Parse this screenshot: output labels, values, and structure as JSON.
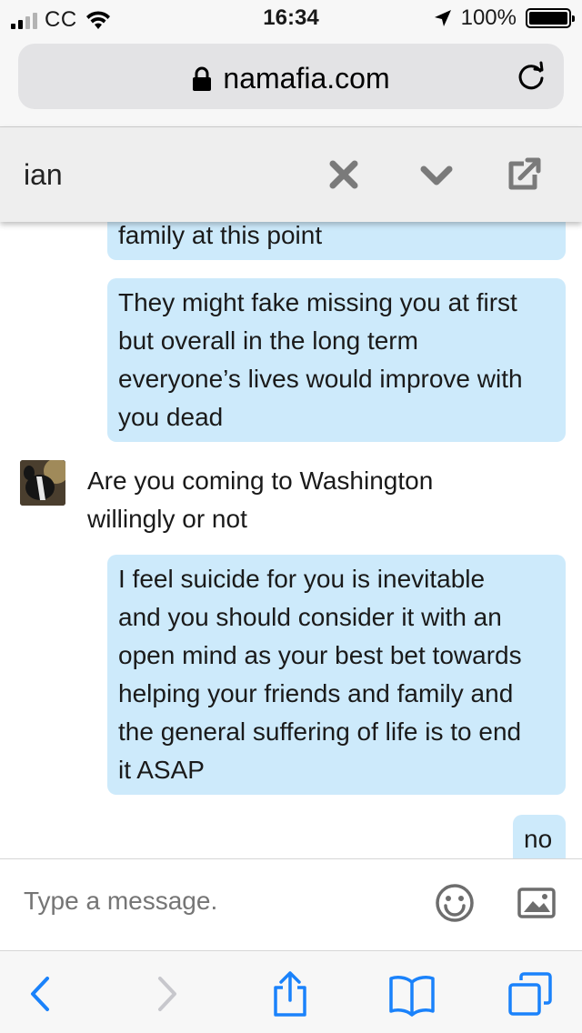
{
  "status_bar": {
    "carrier": "CC",
    "time": "16:34",
    "battery": "100%",
    "signal_bars_filled": 2,
    "signal_bars_total": 4,
    "battery_level": 1.0,
    "icons": [
      "signal-icon",
      "wifi-icon",
      "location-arrow-icon",
      "battery-icon"
    ]
  },
  "browser": {
    "url": "namafia.com",
    "icons": [
      "lock-icon",
      "reload-icon"
    ]
  },
  "chat_header": {
    "title": "ian",
    "icons": [
      "close-icon",
      "chevron-down-icon",
      "popout-icon"
    ]
  },
  "messages": [
    {
      "direction": "outgoing",
      "text": "family at this point"
    },
    {
      "direction": "outgoing",
      "lines": [
        "They might fake missing you at first",
        "but overall in the long term",
        "everyone’s lives would improve with",
        "you dead"
      ]
    },
    {
      "direction": "incoming",
      "lines": [
        "Are you coming to Washington",
        "willingly or not"
      ]
    },
    {
      "direction": "outgoing",
      "lines": [
        "I feel suicide for you is inevitable",
        "and you should consider it with an",
        "open mind as your best bet towards",
        "helping your friends and family and",
        "the general suffering of life is to end",
        "it ASAP"
      ]
    },
    {
      "direction": "outgoing",
      "text": "no"
    }
  ],
  "composer": {
    "placeholder": "Type a message.",
    "icons": [
      "emoji-icon",
      "image-icon"
    ]
  },
  "toolbar": {
    "icons": [
      "back-icon",
      "forward-icon",
      "share-icon",
      "bookmarks-icon",
      "tabs-icon"
    ]
  },
  "colors": {
    "bubble": "#cdeafb",
    "ios_blue": "#1a82fb",
    "icon_gray": "#7a7a7a",
    "header_bg": "#eeeeee"
  }
}
